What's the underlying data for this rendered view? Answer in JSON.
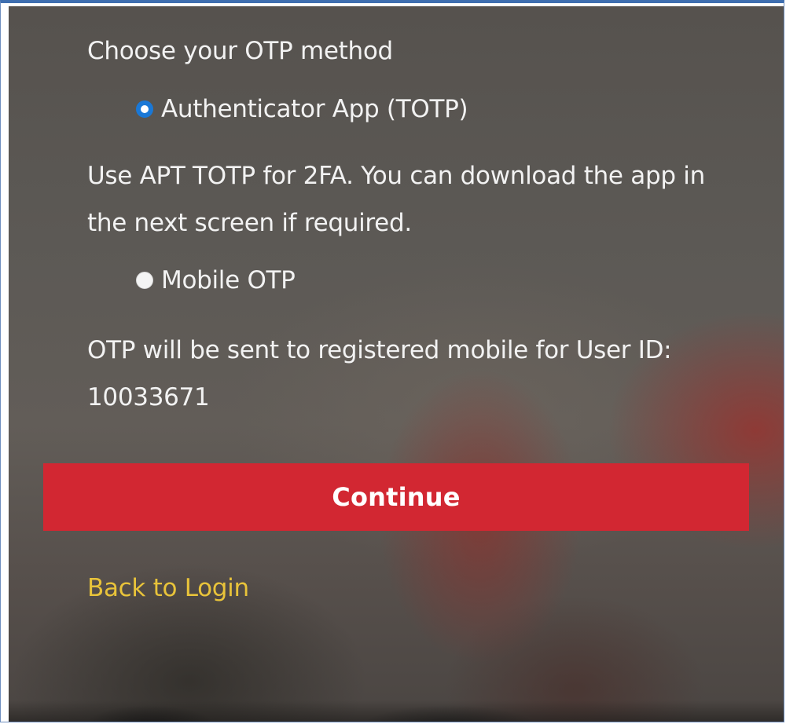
{
  "otp_form": {
    "title": "Choose your OTP method",
    "options": [
      {
        "label": "Authenticator App (TOTP)",
        "selected": true,
        "description": "Use APT TOTP for 2FA. You can download the app in the next screen if required."
      },
      {
        "label": "Mobile OTP",
        "selected": false,
        "description": "OTP will be sent to registered mobile for User ID: 10033671"
      }
    ],
    "continue_label": "Continue",
    "back_link_label": "Back to Login"
  },
  "colors": {
    "accent_button": "#d22732",
    "radio_selected": "#1a78d6",
    "link": "#e8c33a",
    "text": "#f2f2f2"
  },
  "icons": {
    "selected_radio": "radio-checked-icon",
    "unselected_radio": "radio-unchecked-icon"
  }
}
